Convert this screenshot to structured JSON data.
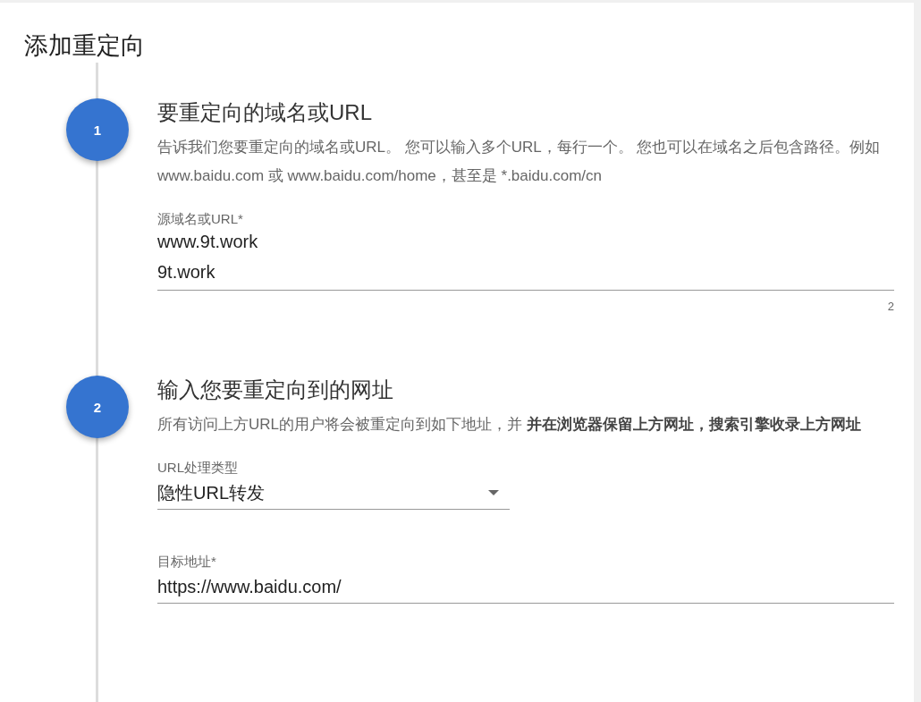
{
  "title": "添加重定向",
  "steps": [
    {
      "number": "1",
      "heading": "要重定向的域名或URL",
      "description": "告诉我们您要重定向的域名或URL。 您可以输入多个URL，每行一个。 您也可以在域名之后包含路径。例如 www.baidu.com 或 www.baidu.com/home，甚至是 *.baidu.com/cn",
      "fields": [
        {
          "kind": "textarea",
          "label": "源域名或URL*",
          "lines": [
            "www.9t.work",
            "9t.work"
          ],
          "counter": "2"
        }
      ]
    },
    {
      "number": "2",
      "heading": "输入您要重定向到的网址",
      "description": "所有访问上方URL的用户将会被重定向到如下地址，并 **并在浏览器保留上方网址，搜索引擎收录上方网址**",
      "fields": [
        {
          "kind": "select",
          "label": "URL处理类型",
          "value": "隐性URL转发"
        },
        {
          "kind": "text",
          "label": "目标地址*",
          "value": "https://www.baidu.com/"
        }
      ]
    }
  ]
}
